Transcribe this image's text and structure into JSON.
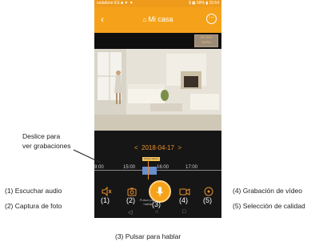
{
  "status_bar": {
    "left": "vodafone ES ■ ▼ ▼",
    "right": "$ ▣ 58% ▮ 15:54"
  },
  "header": {
    "back_icon": "‹",
    "home_icon": "⌂",
    "title": "Mi casa",
    "more_icon": "⋯"
  },
  "hd_button": "HD RES\nINFRA",
  "playback": {
    "prev": "<",
    "date": "2018-04-17",
    "next": ">"
  },
  "timeline": {
    "ticks": [
      "9:00",
      "15:00",
      "16:00",
      "17:00"
    ],
    "marker": "Ahora mismo"
  },
  "controls": {
    "listen_icon": "speaker-off-icon",
    "photo_icon": "camera-icon",
    "mic_icon": "microphone-icon",
    "record_icon": "video-icon",
    "quality_icon": "quality-icon",
    "mic_label": "Pulsar para hablar",
    "n1": "(1)",
    "n2": "(2)",
    "n3": "(3)",
    "n4": "(4)",
    "n5": "(5)"
  },
  "annotations": {
    "deslice": "Deslice para\nver grabaciones",
    "a1": "(1) Escuchar audio",
    "a2": "(2) Captura de foto",
    "a4": "(4) Grabación de vídeo",
    "a5": "(5) Selección de calidad",
    "a3": "(3) Pulsar para hablar"
  },
  "colors": {
    "accent": "#f5a21a",
    "timeline_segment": "#6a8fd1",
    "phone_bg": "#161616"
  }
}
